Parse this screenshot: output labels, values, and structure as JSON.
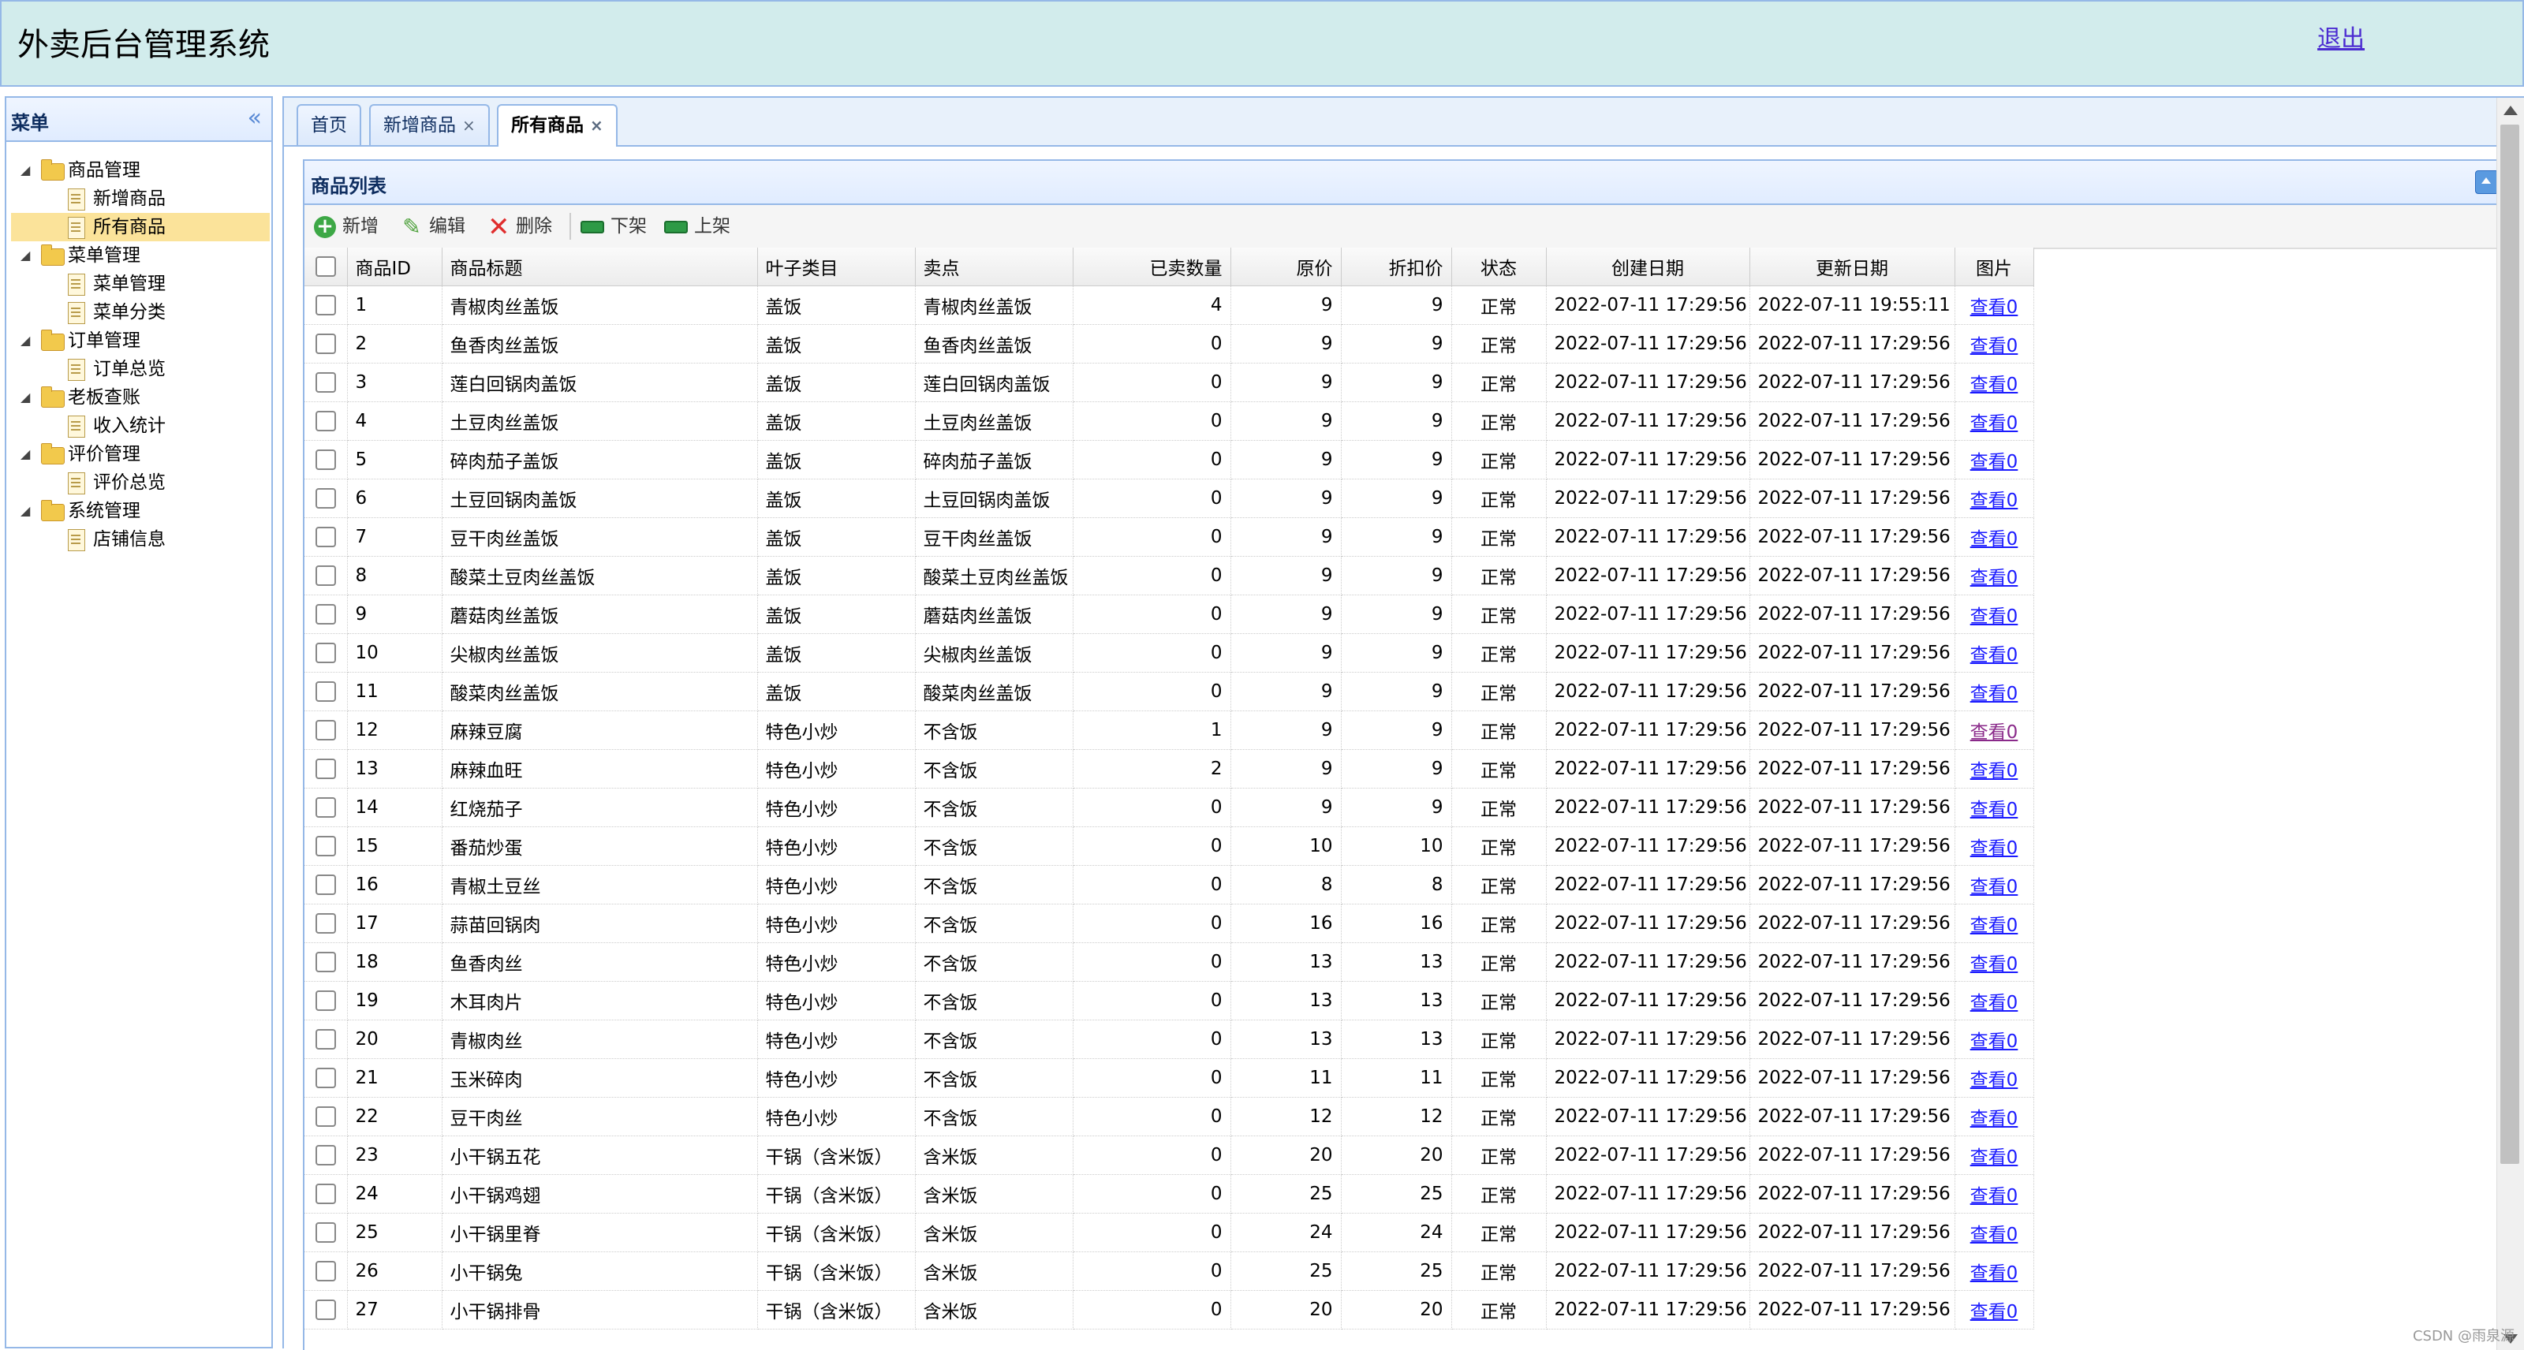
{
  "header": {
    "title": "外卖后台管理系统",
    "logout": "退出"
  },
  "menu": {
    "title": "菜单",
    "collapse_glyph": "«",
    "groups": [
      {
        "label": "商品管理",
        "items": [
          "新增商品",
          "所有商品"
        ]
      },
      {
        "label": "菜单管理",
        "items": [
          "菜单管理",
          "菜单分类"
        ]
      },
      {
        "label": "订单管理",
        "items": [
          "订单总览"
        ]
      },
      {
        "label": "老板查账",
        "items": [
          "收入统计"
        ]
      },
      {
        "label": "评价管理",
        "items": [
          "评价总览"
        ]
      },
      {
        "label": "系统管理",
        "items": [
          "店铺信息"
        ]
      }
    ],
    "selected_item": "所有商品"
  },
  "tabs": [
    {
      "label": "首页",
      "closable": false
    },
    {
      "label": "新增商品",
      "closable": true
    },
    {
      "label": "所有商品",
      "closable": true,
      "active": true
    }
  ],
  "grid": {
    "title": "商品列表",
    "toolbar": {
      "add": "新增",
      "edit": "编辑",
      "delete": "删除",
      "off_shelf": "下架",
      "on_shelf": "上架"
    },
    "columns": [
      "商品ID",
      "商品标题",
      "叶子类目",
      "卖点",
      "已卖数量",
      "原价",
      "折扣价",
      "状态",
      "创建日期",
      "更新日期",
      "图片"
    ],
    "rows": [
      [
        "1",
        "青椒肉丝盖饭",
        "盖饭",
        "青椒肉丝盖饭",
        "4",
        "9",
        "9",
        "正常",
        "2022-07-11 17:29:56",
        "2022-07-11 19:55:11",
        "查看0"
      ],
      [
        "2",
        "鱼香肉丝盖饭",
        "盖饭",
        "鱼香肉丝盖饭",
        "0",
        "9",
        "9",
        "正常",
        "2022-07-11 17:29:56",
        "2022-07-11 17:29:56",
        "查看0"
      ],
      [
        "3",
        "莲白回锅肉盖饭",
        "盖饭",
        "莲白回锅肉盖饭",
        "0",
        "9",
        "9",
        "正常",
        "2022-07-11 17:29:56",
        "2022-07-11 17:29:56",
        "查看0"
      ],
      [
        "4",
        "土豆肉丝盖饭",
        "盖饭",
        "土豆肉丝盖饭",
        "0",
        "9",
        "9",
        "正常",
        "2022-07-11 17:29:56",
        "2022-07-11 17:29:56",
        "查看0"
      ],
      [
        "5",
        "碎肉茄子盖饭",
        "盖饭",
        "碎肉茄子盖饭",
        "0",
        "9",
        "9",
        "正常",
        "2022-07-11 17:29:56",
        "2022-07-11 17:29:56",
        "查看0"
      ],
      [
        "6",
        "土豆回锅肉盖饭",
        "盖饭",
        "土豆回锅肉盖饭",
        "0",
        "9",
        "9",
        "正常",
        "2022-07-11 17:29:56",
        "2022-07-11 17:29:56",
        "查看0"
      ],
      [
        "7",
        "豆干肉丝盖饭",
        "盖饭",
        "豆干肉丝盖饭",
        "0",
        "9",
        "9",
        "正常",
        "2022-07-11 17:29:56",
        "2022-07-11 17:29:56",
        "查看0"
      ],
      [
        "8",
        "酸菜土豆肉丝盖饭",
        "盖饭",
        "酸菜土豆肉丝盖饭",
        "0",
        "9",
        "9",
        "正常",
        "2022-07-11 17:29:56",
        "2022-07-11 17:29:56",
        "查看0"
      ],
      [
        "9",
        "蘑菇肉丝盖饭",
        "盖饭",
        "蘑菇肉丝盖饭",
        "0",
        "9",
        "9",
        "正常",
        "2022-07-11 17:29:56",
        "2022-07-11 17:29:56",
        "查看0"
      ],
      [
        "10",
        "尖椒肉丝盖饭",
        "盖饭",
        "尖椒肉丝盖饭",
        "0",
        "9",
        "9",
        "正常",
        "2022-07-11 17:29:56",
        "2022-07-11 17:29:56",
        "查看0"
      ],
      [
        "11",
        "酸菜肉丝盖饭",
        "盖饭",
        "酸菜肉丝盖饭",
        "0",
        "9",
        "9",
        "正常",
        "2022-07-11 17:29:56",
        "2022-07-11 17:29:56",
        "查看0"
      ],
      [
        "12",
        "麻辣豆腐",
        "特色小炒",
        "不含饭",
        "1",
        "9",
        "9",
        "正常",
        "2022-07-11 17:29:56",
        "2022-07-11 17:29:56",
        "查看0"
      ],
      [
        "13",
        "麻辣血旺",
        "特色小炒",
        "不含饭",
        "2",
        "9",
        "9",
        "正常",
        "2022-07-11 17:29:56",
        "2022-07-11 17:29:56",
        "查看0"
      ],
      [
        "14",
        "红烧茄子",
        "特色小炒",
        "不含饭",
        "0",
        "9",
        "9",
        "正常",
        "2022-07-11 17:29:56",
        "2022-07-11 17:29:56",
        "查看0"
      ],
      [
        "15",
        "番茄炒蛋",
        "特色小炒",
        "不含饭",
        "0",
        "10",
        "10",
        "正常",
        "2022-07-11 17:29:56",
        "2022-07-11 17:29:56",
        "查看0"
      ],
      [
        "16",
        "青椒土豆丝",
        "特色小炒",
        "不含饭",
        "0",
        "8",
        "8",
        "正常",
        "2022-07-11 17:29:56",
        "2022-07-11 17:29:56",
        "查看0"
      ],
      [
        "17",
        "蒜苗回锅肉",
        "特色小炒",
        "不含饭",
        "0",
        "16",
        "16",
        "正常",
        "2022-07-11 17:29:56",
        "2022-07-11 17:29:56",
        "查看0"
      ],
      [
        "18",
        "鱼香肉丝",
        "特色小炒",
        "不含饭",
        "0",
        "13",
        "13",
        "正常",
        "2022-07-11 17:29:56",
        "2022-07-11 17:29:56",
        "查看0"
      ],
      [
        "19",
        "木耳肉片",
        "特色小炒",
        "不含饭",
        "0",
        "13",
        "13",
        "正常",
        "2022-07-11 17:29:56",
        "2022-07-11 17:29:56",
        "查看0"
      ],
      [
        "20",
        "青椒肉丝",
        "特色小炒",
        "不含饭",
        "0",
        "13",
        "13",
        "正常",
        "2022-07-11 17:29:56",
        "2022-07-11 17:29:56",
        "查看0"
      ],
      [
        "21",
        "玉米碎肉",
        "特色小炒",
        "不含饭",
        "0",
        "11",
        "11",
        "正常",
        "2022-07-11 17:29:56",
        "2022-07-11 17:29:56",
        "查看0"
      ],
      [
        "22",
        "豆干肉丝",
        "特色小炒",
        "不含饭",
        "0",
        "12",
        "12",
        "正常",
        "2022-07-11 17:29:56",
        "2022-07-11 17:29:56",
        "查看0"
      ],
      [
        "23",
        "小干锅五花",
        "干锅（含米饭）",
        "含米饭",
        "0",
        "20",
        "20",
        "正常",
        "2022-07-11 17:29:56",
        "2022-07-11 17:29:56",
        "查看0"
      ],
      [
        "24",
        "小干锅鸡翅",
        "干锅（含米饭）",
        "含米饭",
        "0",
        "25",
        "25",
        "正常",
        "2022-07-11 17:29:56",
        "2022-07-11 17:29:56",
        "查看0"
      ],
      [
        "25",
        "小干锅里脊",
        "干锅（含米饭）",
        "含米饭",
        "0",
        "24",
        "24",
        "正常",
        "2022-07-11 17:29:56",
        "2022-07-11 17:29:56",
        "查看0"
      ],
      [
        "26",
        "小干锅兔",
        "干锅（含米饭）",
        "含米饭",
        "0",
        "25",
        "25",
        "正常",
        "2022-07-11 17:29:56",
        "2022-07-11 17:29:56",
        "查看0"
      ],
      [
        "27",
        "小干锅排骨",
        "干锅（含米饭）",
        "含米饭",
        "0",
        "20",
        "20",
        "正常",
        "2022-07-11 17:29:56",
        "2022-07-11 17:29:56",
        "查看0"
      ]
    ],
    "visited_row_ids": [
      "12"
    ]
  },
  "watermark": "CSDN @雨泉源",
  "colors": {
    "header_bg": "#d2ecec",
    "panel_border": "#95b8e7",
    "selected_item_bg": "#fbe39a",
    "link": "#1a1aff"
  }
}
